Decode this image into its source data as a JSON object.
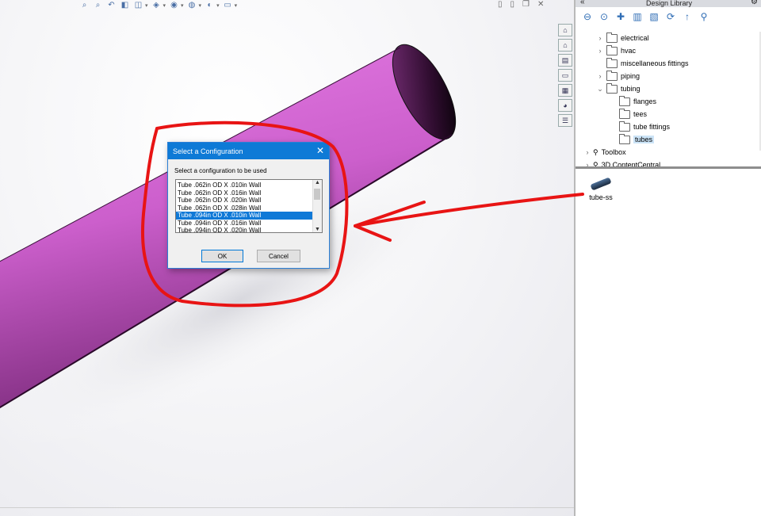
{
  "colors": {
    "tube": "#cc66cc",
    "annotation": "#e81414",
    "dialog_title_bg": "#0e7ad6",
    "selection": "#0f79d7"
  },
  "toolbar": {
    "icons": [
      "zoom-to-fit-icon",
      "zoom-area-icon",
      "previous-view-icon",
      "section-view-icon",
      "view-orientation-icon",
      "display-style-icon",
      "hide-show-icon",
      "edit-appearance-icon",
      "apply-scene-icon",
      "view-settings-icon"
    ]
  },
  "window_controls": [
    "restore",
    "minimize",
    "maximize",
    "close"
  ],
  "task_pane": {
    "tabs": [
      "resources-icon",
      "home-icon",
      "design-library-icon",
      "file-explorer-icon",
      "view-palette-icon",
      "appearances-icon",
      "custom-properties-icon"
    ],
    "title": "Design Library",
    "toolbar_icons": [
      "back-icon",
      "forward-icon",
      "add-to-library-icon",
      "add-file-location-icon",
      "create-folder-icon",
      "refresh-icon",
      "up-one-level-icon",
      "toolbox-icon"
    ],
    "tree": [
      {
        "label": "electrical",
        "indent": 1,
        "expanded": false,
        "has_children": true
      },
      {
        "label": "hvac",
        "indent": 1,
        "expanded": false,
        "has_children": true
      },
      {
        "label": "miscellaneous fittings",
        "indent": 1,
        "expanded": false,
        "has_children": false
      },
      {
        "label": "piping",
        "indent": 1,
        "expanded": false,
        "has_children": true
      },
      {
        "label": "tubing",
        "indent": 1,
        "expanded": true,
        "has_children": true
      },
      {
        "label": "flanges",
        "indent": 2,
        "expanded": false,
        "has_children": false
      },
      {
        "label": "tees",
        "indent": 2,
        "expanded": false,
        "has_children": false
      },
      {
        "label": "tube fittings",
        "indent": 2,
        "expanded": false,
        "has_children": false
      },
      {
        "label": "tubes",
        "indent": 2,
        "expanded": false,
        "has_children": false,
        "selected": true
      },
      {
        "label": "Toolbox",
        "indent": 0,
        "expanded": false,
        "has_children": true
      },
      {
        "label": "3D ContentCentral",
        "indent": 0,
        "expanded": false,
        "has_children": true
      }
    ],
    "preview_item": "tube-ss"
  },
  "dialog": {
    "title": "Select a Configuration",
    "prompt": "Select a configuration to be used",
    "configurations": [
      "Tube .062in OD X .010in Wall",
      "Tube .062in OD X .016in Wall",
      "Tube .062in OD X .020in Wall",
      "Tube .062in OD X .028in Wall",
      "Tube .094in OD X .010in Wall",
      "Tube .094in OD X .016in Wall",
      "Tube .094in OD X .020in Wall"
    ],
    "selected_index": 4,
    "ok_label": "OK",
    "cancel_label": "Cancel"
  }
}
